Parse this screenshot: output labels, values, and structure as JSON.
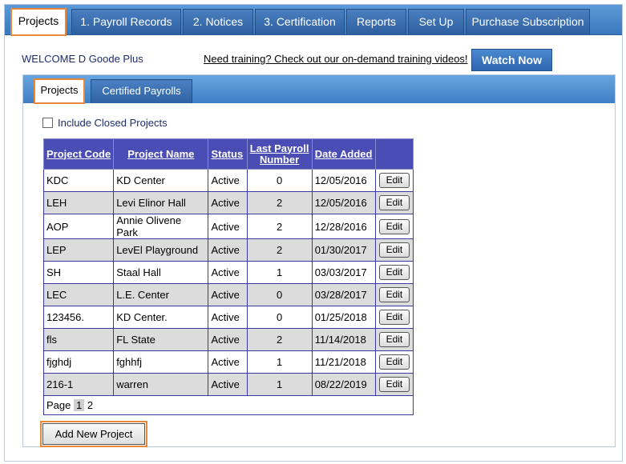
{
  "top_tabs": [
    {
      "label": "Projects"
    },
    {
      "label": "1. Payroll Records"
    },
    {
      "label": "2. Notices"
    },
    {
      "label": "3. Certification"
    },
    {
      "label": "Reports"
    },
    {
      "label": "Set Up"
    },
    {
      "label": "Purchase Subscription"
    }
  ],
  "header": {
    "welcome": "WELCOME D Goode Plus",
    "training_link": "Need training? Check out our on-demand training videos!",
    "watch_now": "Watch Now"
  },
  "sub_tabs": [
    {
      "label": "Projects"
    },
    {
      "label": "Certified Payrolls"
    }
  ],
  "include_closed_label": "Include Closed Projects",
  "table": {
    "columns": [
      "Project Code",
      "Project Name",
      "Status",
      "Last Payroll Number",
      "Date Added"
    ],
    "edit_label": "Edit",
    "rows": [
      {
        "code": "KDC",
        "name": "KD Center",
        "status": "Active",
        "last": "0",
        "date": "12/05/2016"
      },
      {
        "code": "LEH",
        "name": "Levi Elinor Hall",
        "status": "Active",
        "last": "2",
        "date": "12/05/2016"
      },
      {
        "code": "AOP",
        "name": "Annie Olivene Park",
        "status": "Active",
        "last": "2",
        "date": "12/28/2016"
      },
      {
        "code": "LEP",
        "name": "LevEl Playground",
        "status": "Active",
        "last": "2",
        "date": "01/30/2017"
      },
      {
        "code": "SH",
        "name": "Staal Hall",
        "status": "Active",
        "last": "1",
        "date": "03/03/2017"
      },
      {
        "code": "LEC",
        "name": "L.E. Center",
        "status": "Active",
        "last": "0",
        "date": "03/28/2017"
      },
      {
        "code": "123456.",
        "name": "KD Center.",
        "status": "Active",
        "last": "0",
        "date": "01/25/2018"
      },
      {
        "code": "fls",
        "name": "FL State",
        "status": "Active",
        "last": "2",
        "date": "11/14/2018"
      },
      {
        "code": "fjghdj",
        "name": "fghhfj",
        "status": "Active",
        "last": "1",
        "date": "11/21/2018"
      },
      {
        "code": "216-1",
        "name": "warren",
        "status": "Active",
        "last": "1",
        "date": "08/22/2019"
      }
    ],
    "pager": {
      "label": "Page",
      "current": "1",
      "other": "2"
    }
  },
  "add_new_project": "Add New Project"
}
